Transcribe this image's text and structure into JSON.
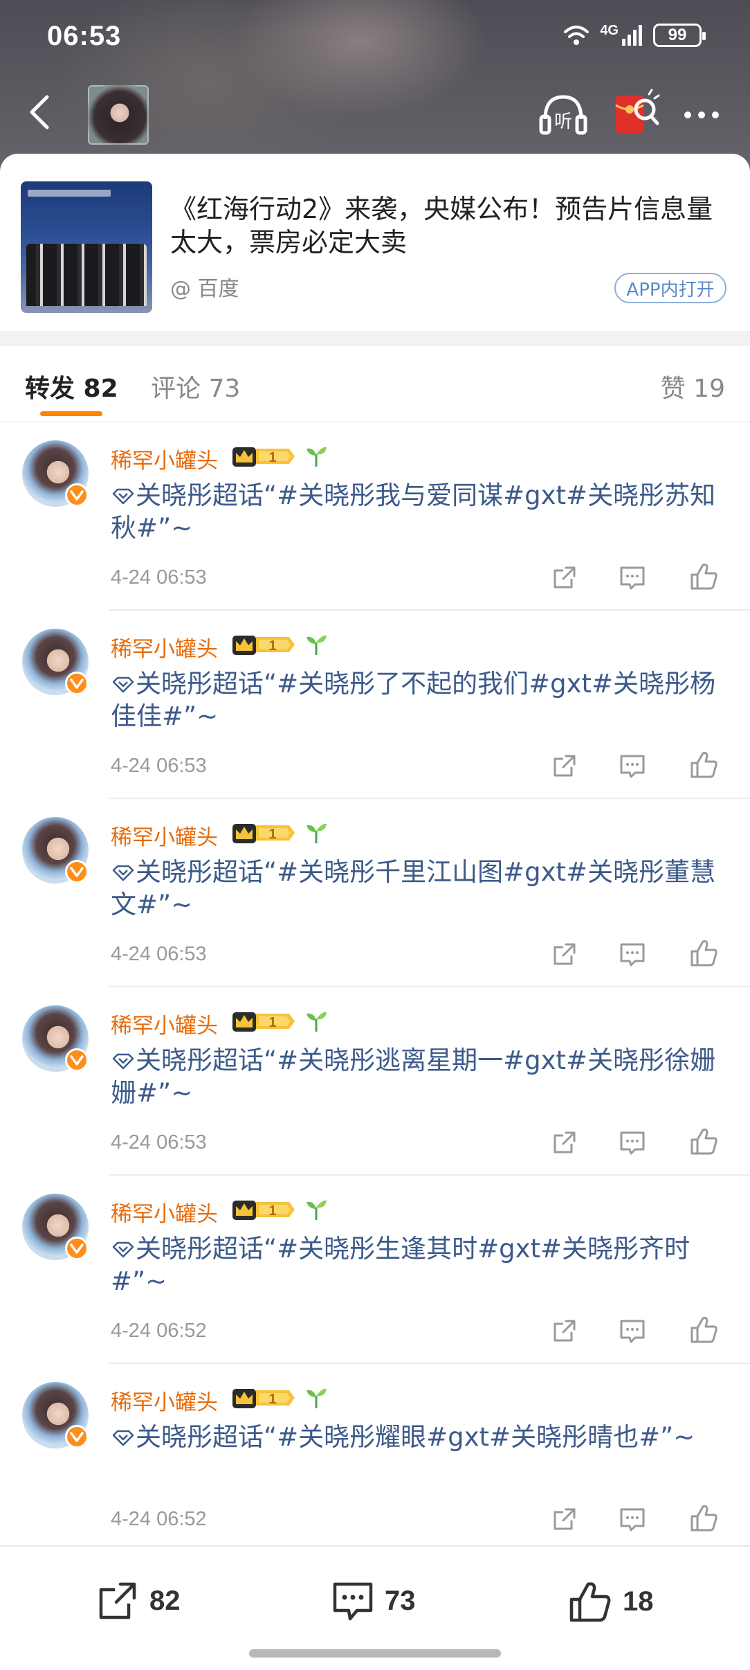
{
  "status_bar": {
    "time": "06:53",
    "network": "4G",
    "battery": "99"
  },
  "nav": {
    "back_icon": "chevron-left-icon",
    "listen_label": "听",
    "redpack_icon": "red-envelope-icon",
    "more_icon": "more-dots-icon"
  },
  "article": {
    "title": "《红海行动2》来袭，央媒公布！预告片信息量太大，票房必定大卖",
    "source": "@ 百度",
    "open_app": "APP内打开"
  },
  "tabs": {
    "repost": "转发 82",
    "comment": "评论 73",
    "like": "赞 19"
  },
  "reposts": [
    {
      "username": "稀罕小罐头",
      "vip_level": "1",
      "text": "关晓彤超话“#关晓彤我与爱同谋#gxt#关晓彤苏知秋#”~",
      "time": "4-24 06:53"
    },
    {
      "username": "稀罕小罐头",
      "vip_level": "1",
      "text": "关晓彤超话“#关晓彤了不起的我们#gxt#关晓彤杨佳佳#”~",
      "time": "4-24 06:53"
    },
    {
      "username": "稀罕小罐头",
      "vip_level": "1",
      "text": "关晓彤超话“#关晓彤千里江山图#gxt#关晓彤董慧文#”~",
      "time": "4-24 06:53"
    },
    {
      "username": "稀罕小罐头",
      "vip_level": "1",
      "text": "关晓彤超话“#关晓彤逃离星期一#gxt#关晓彤徐姗姗#”~",
      "time": "4-24 06:53"
    },
    {
      "username": "稀罕小罐头",
      "vip_level": "1",
      "text": "关晓彤超话“#关晓彤生逢其时#gxt#关晓彤齐时#”~",
      "time": "4-24 06:52"
    },
    {
      "username": "稀罕小罐头",
      "vip_level": "1",
      "text": "关晓彤超话“#关晓彤耀眼#gxt#关晓彤晴也#”~",
      "time": "4-24 06:52"
    }
  ],
  "bottom_bar": {
    "share_count": "82",
    "comment_count": "73",
    "like_count": "18"
  },
  "colors": {
    "accent": "#ff8200",
    "username": "#e86b0a",
    "link_text": "#3c5a8a"
  }
}
